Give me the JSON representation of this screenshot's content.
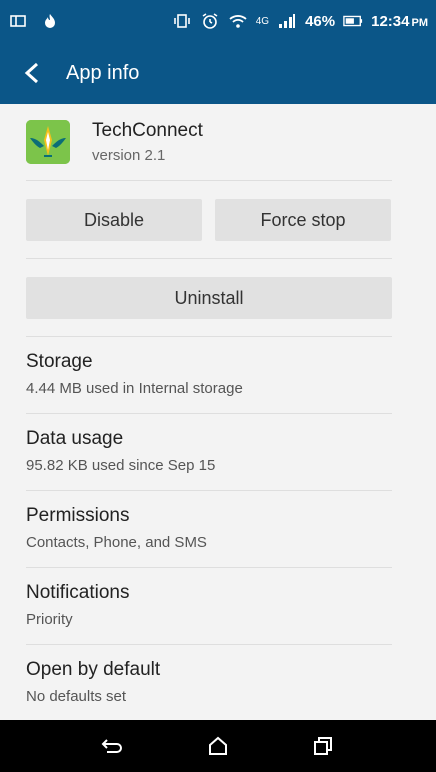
{
  "status_bar": {
    "battery": "46%",
    "time": "12:34",
    "ampm": "PM",
    "network": "4G",
    "icons": [
      "notification-icon",
      "fire-icon",
      "vibrate-icon",
      "alarm-icon",
      "wifi-icon",
      "signal-icon",
      "battery-icon"
    ]
  },
  "appbar": {
    "title": "App info",
    "back_icon": "arrow-back-icon"
  },
  "app": {
    "name": "TechConnect",
    "version": "version 2.1",
    "logo_color": "#7cc44a"
  },
  "buttons": {
    "disable": "Disable",
    "force_stop": "Force stop",
    "uninstall": "Uninstall"
  },
  "sections": [
    {
      "title": "Storage",
      "subtitle": "4.44 MB used in Internal storage"
    },
    {
      "title": "Data usage",
      "subtitle": "95.82 KB used since Sep 15"
    },
    {
      "title": "Permissions",
      "subtitle": "Contacts, Phone, and SMS"
    },
    {
      "title": "Notifications",
      "subtitle": "Priority"
    },
    {
      "title": "Open by default",
      "subtitle": "No defaults set"
    }
  ],
  "navbar": {
    "icons": [
      "back-nav-icon",
      "home-nav-icon",
      "recents-nav-icon"
    ]
  },
  "colors": {
    "primary": "#0b5688",
    "background": "#f3f3f3",
    "button": "#e1e1e1"
  }
}
